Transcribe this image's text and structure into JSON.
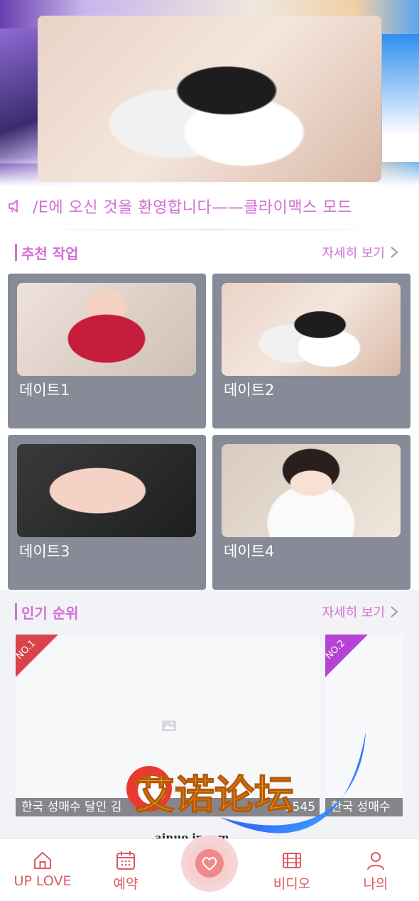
{
  "notice": {
    "text": "/E에 오신 것을 환영합니다——클라이맥스 모드"
  },
  "recommended": {
    "title": "추천 작업",
    "more": "자세히 보기",
    "items": [
      {
        "title": "데이트1"
      },
      {
        "title": "데이트2"
      },
      {
        "title": "데이트3"
      },
      {
        "title": "데이트4"
      }
    ]
  },
  "popular": {
    "title": "인기 순위",
    "more": "자세히 보기",
    "items": [
      {
        "rank": "NO.1",
        "caption": "한국 성매수 달인 김 ",
        "count": "1545",
        "ribbon_color": "#d8434c"
      },
      {
        "rank": "NO.2",
        "caption": "한국 성매수",
        "ribbon_color": "#b543d4"
      }
    ]
  },
  "watermark": {
    "title": "艾诺论坛",
    "site": "ainuo.ir.com"
  },
  "tabbar": {
    "items": [
      {
        "label": "UP LOVE",
        "icon": "home-icon"
      },
      {
        "label": "예약",
        "icon": "calendar-icon"
      },
      {
        "label": "",
        "icon": "heart-icon"
      },
      {
        "label": "비디오",
        "icon": "film-icon"
      },
      {
        "label": "나의",
        "icon": "user-icon"
      }
    ]
  },
  "colors": {
    "accent": "#d36fd4",
    "tab_active": "#dd5a63",
    "card_bg": "#868b97"
  }
}
